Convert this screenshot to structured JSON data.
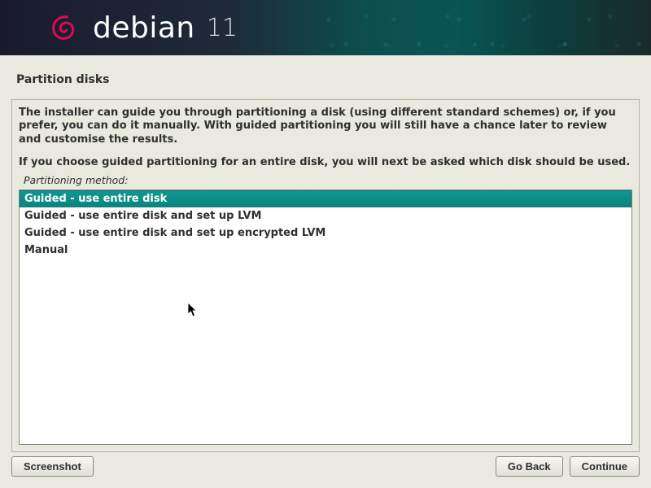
{
  "brand": {
    "name": "debian",
    "version": "11"
  },
  "page_title": "Partition disks",
  "description_1": "The installer can guide you through partitioning a disk (using different standard schemes) or, if you prefer, you can do it manually. With guided partitioning you will still have a chance later to review and customise the results.",
  "description_2": "If you choose guided partitioning for an entire disk, you will next be asked which disk should be used.",
  "method_label": "Partitioning method:",
  "options": [
    {
      "label": "Guided - use entire disk"
    },
    {
      "label": "Guided - use entire disk and set up LVM"
    },
    {
      "label": "Guided - use entire disk and set up encrypted LVM"
    },
    {
      "label": "Manual"
    }
  ],
  "buttons": {
    "screenshot": "Screenshot",
    "go_back": "Go Back",
    "continue": "Continue"
  }
}
